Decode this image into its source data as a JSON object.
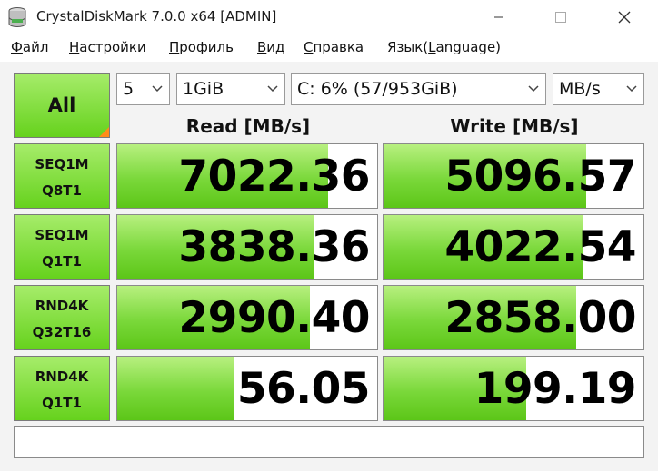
{
  "window": {
    "title": "CrystalDiskMark 7.0.0 x64 [ADMIN]"
  },
  "menu": [
    {
      "label": "Файл",
      "mnemonic": "Ф",
      "rest": "айл"
    },
    {
      "label": "Настройки",
      "mnemonic": "Н",
      "rest": "астройки"
    },
    {
      "label": "Профиль",
      "mnemonic": "П",
      "rest": "рофиль"
    },
    {
      "label": "Вид",
      "mnemonic": "В",
      "rest": "ид"
    },
    {
      "label": "Справка",
      "mnemonic": "С",
      "rest": "правка"
    },
    {
      "label": "Язык(Language)",
      "pre": "Язык(",
      "mnemonic": "L",
      "rest": "anguage)"
    }
  ],
  "controls": {
    "all_label": "All",
    "count_value": "5",
    "size_value": "1GiB",
    "drive_value": "C: 6% (57/953GiB)",
    "unit_value": "MB/s"
  },
  "headers": {
    "read": "Read [MB/s]",
    "write": "Write [MB/s]"
  },
  "tests": [
    {
      "line1": "SEQ1M",
      "line2": "Q8T1",
      "read": "7022.36",
      "write": "5096.57",
      "read_fill": 0.81,
      "write_fill": 0.78
    },
    {
      "line1": "SEQ1M",
      "line2": "Q1T1",
      "read": "3838.36",
      "write": "4022.54",
      "read_fill": 0.76,
      "write_fill": 0.77
    },
    {
      "line1": "RND4K",
      "line2": "Q32T16",
      "read": "2990.40",
      "write": "2858.00",
      "read_fill": 0.74,
      "write_fill": 0.74
    },
    {
      "line1": "RND4K",
      "line2": "Q1T1",
      "read": "56.05",
      "write": "199.19",
      "read_fill": 0.45,
      "write_fill": 0.55
    }
  ],
  "comment": "",
  "colors": {
    "bar_green": "#66d21d",
    "corner_orange": "#ff8c1a"
  }
}
